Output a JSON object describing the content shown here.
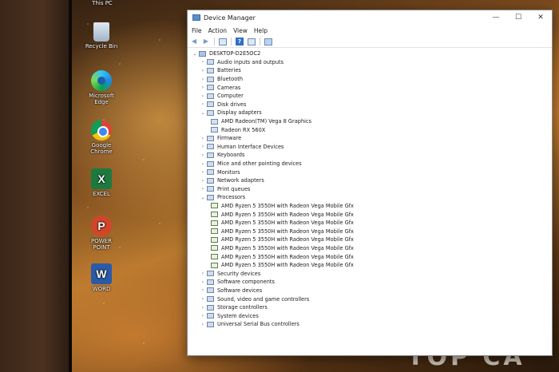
{
  "desktop": {
    "icons": [
      {
        "label": "This PC",
        "icon": "this-pc-icon"
      },
      {
        "label": "Recycle Bin",
        "icon": "recycle-bin-icon"
      },
      {
        "label": "Microsoft Edge",
        "icon": "edge-icon"
      },
      {
        "label": "Google Chrome",
        "icon": "chrome-icon"
      },
      {
        "label": "EXCEL",
        "icon": "excel-icon"
      },
      {
        "label": "POWER POINT",
        "icon": "powerpoint-icon"
      },
      {
        "label": "WORD",
        "icon": "word-icon"
      }
    ],
    "glyphs": {
      "excel": "X",
      "powerpoint": "P",
      "word": "W"
    }
  },
  "window": {
    "title": "Device Manager",
    "controls": {
      "minimize": "—",
      "maximize": "☐",
      "close": "✕"
    },
    "menu": [
      "File",
      "Action",
      "View",
      "Help"
    ],
    "toolbar": {
      "back": "◀",
      "forward": "▶",
      "help": "?"
    }
  },
  "tree": {
    "root": "DESKTOP-D2E5OC2",
    "categories": [
      {
        "label": "Audio inputs and outputs",
        "expanded": false
      },
      {
        "label": "Batteries",
        "expanded": false
      },
      {
        "label": "Bluetooth",
        "expanded": false
      },
      {
        "label": "Cameras",
        "expanded": false
      },
      {
        "label": "Computer",
        "expanded": false
      },
      {
        "label": "Disk drives",
        "expanded": false
      },
      {
        "label": "Display adapters",
        "expanded": true,
        "children": [
          "AMD Radeon(TM) Vega 8 Graphics",
          "Radeon RX 560X"
        ]
      },
      {
        "label": "Firmware",
        "expanded": false
      },
      {
        "label": "Human Interface Devices",
        "expanded": false
      },
      {
        "label": "Keyboards",
        "expanded": false
      },
      {
        "label": "Mice and other pointing devices",
        "expanded": false
      },
      {
        "label": "Monitors",
        "expanded": false
      },
      {
        "label": "Network adapters",
        "expanded": false
      },
      {
        "label": "Print queues",
        "expanded": false
      },
      {
        "label": "Processors",
        "expanded": true,
        "children": [
          "AMD Ryzen 5 3550H with Radeon Vega Mobile Gfx",
          "AMD Ryzen 5 3550H with Radeon Vega Mobile Gfx",
          "AMD Ryzen 5 3550H with Radeon Vega Mobile Gfx",
          "AMD Ryzen 5 3550H with Radeon Vega Mobile Gfx",
          "AMD Ryzen 5 3550H with Radeon Vega Mobile Gfx",
          "AMD Ryzen 5 3550H with Radeon Vega Mobile Gfx",
          "AMD Ryzen 5 3550H with Radeon Vega Mobile Gfx",
          "AMD Ryzen 5 3550H with Radeon Vega Mobile Gfx"
        ]
      },
      {
        "label": "Security devices",
        "expanded": false
      },
      {
        "label": "Software components",
        "expanded": false
      },
      {
        "label": "Software devices",
        "expanded": false
      },
      {
        "label": "Sound, video and game controllers",
        "expanded": false
      },
      {
        "label": "Storage controllers",
        "expanded": false
      },
      {
        "label": "System devices",
        "expanded": false
      },
      {
        "label": "Universal Serial Bus controllers",
        "expanded": false
      }
    ],
    "chevron_collapsed": "›",
    "chevron_expanded": "⌄"
  },
  "background_text": "TOP CA"
}
